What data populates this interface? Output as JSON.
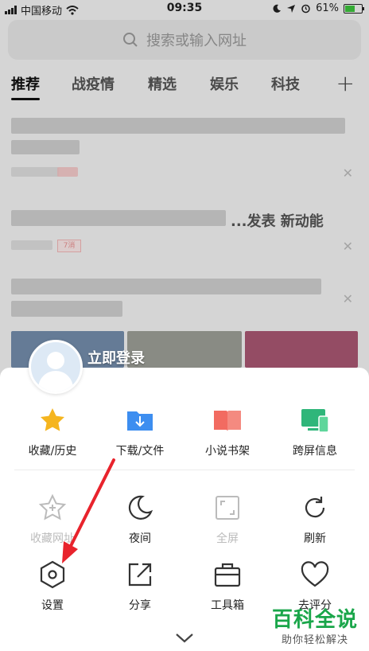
{
  "status_bar": {
    "carrier": "中国移动",
    "time": "09:35",
    "battery": "61%",
    "battery_level": 0.61,
    "icons": [
      "signal-icon",
      "wifi-icon",
      "moon-icon",
      "location-icon",
      "alarm-icon",
      "battery-icon"
    ]
  },
  "search": {
    "placeholder": "搜索或输入网址"
  },
  "tabs": [
    {
      "label": "推荐",
      "active": true
    },
    {
      "label": "战疫情"
    },
    {
      "label": "精选"
    },
    {
      "label": "娱乐"
    },
    {
      "label": "科技"
    }
  ],
  "feed": {
    "partial_text": "...发表 新动能",
    "tag": "7消"
  },
  "sheet": {
    "login_label": "立即登录",
    "row1": [
      {
        "label": "收藏/历史",
        "icon": "star-icon",
        "color": "#f5b51f"
      },
      {
        "label": "下载/文件",
        "icon": "download-folder-icon",
        "color": "#3d8ef0"
      },
      {
        "label": "小说书架",
        "icon": "book-icon",
        "color": "#f26b61"
      },
      {
        "label": "跨屏信息",
        "icon": "devices-icon",
        "color": "#2fb67a"
      }
    ],
    "row2": [
      {
        "label": "收藏网址",
        "icon": "star-plus-icon",
        "disabled": true
      },
      {
        "label": "夜间",
        "icon": "moon-icon"
      },
      {
        "label": "全屏",
        "icon": "fullscreen-icon",
        "disabled": true
      },
      {
        "label": "刷新",
        "icon": "refresh-icon"
      }
    ],
    "row3": [
      {
        "label": "设置",
        "icon": "settings-hexagon-icon"
      },
      {
        "label": "分享",
        "icon": "share-icon"
      },
      {
        "label": "工具箱",
        "icon": "toolbox-icon"
      },
      {
        "label": "去评分",
        "icon": "heart-icon"
      }
    ]
  },
  "watermark": {
    "title": "百科全说",
    "subtitle": "助你轻松解决"
  },
  "colors": {
    "annotation_arrow": "#e8232c",
    "watermark_green": "#1aa64a"
  }
}
